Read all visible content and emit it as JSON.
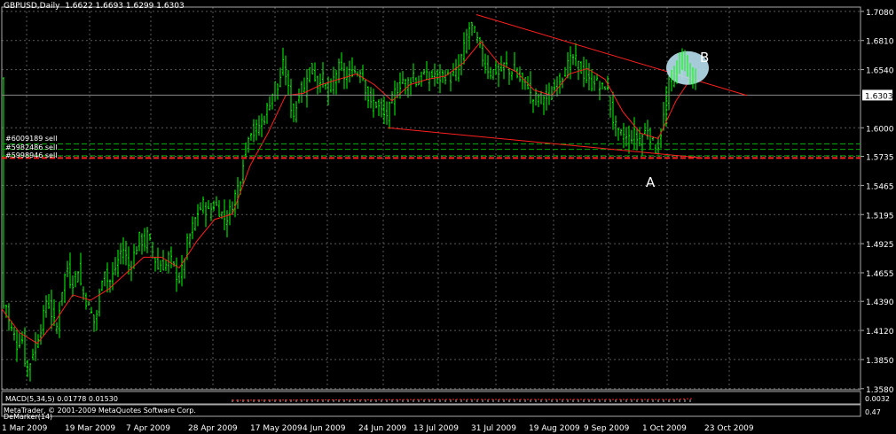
{
  "header": {
    "symbol": "GBPUSD,Daily",
    "ohlc": "1.6622 1.6693 1.6299 1.6303"
  },
  "orders": [
    {
      "label": "#6009189 sell",
      "price": 1.585
    },
    {
      "label": "#5982486 sell",
      "price": 1.58
    },
    {
      "label": "#5998946 sell",
      "price": 1.574
    }
  ],
  "red_level": 1.572,
  "annotations": {
    "a": "A",
    "b": "B"
  },
  "macd": {
    "label": "MACD(5,34,5) 0.01778 0.01530",
    "right_values": [
      "0.0032",
      "0.00"
    ],
    "copyright": "MetaTrader, © 2001-2009 MetaQuotes Software Corp.",
    "lower_label": "DeMarker(14)",
    "lower_value": "0.47"
  },
  "colors": {
    "background": "#000000",
    "grid": "#5a5a5a",
    "bar": "#00ff00",
    "ma": "#ff2020",
    "trendline": "#ff2020",
    "order_line": "#00aa00",
    "highlight": "#b8e0ee"
  },
  "chart_data": {
    "type": "ohlc",
    "symbol": "GBPUSD",
    "timeframe": "Daily",
    "ylim": [
      1.357,
      1.712
    ],
    "y_ticks": [
      "1.7080",
      "1.6810",
      "1.6540",
      "1.6303",
      "1.6000",
      "1.5735",
      "1.5465",
      "1.5195",
      "1.4925",
      "1.4655",
      "1.4390",
      "1.4120",
      "1.3850",
      "1.3580"
    ],
    "current_price": "1.6303",
    "x_ticks": [
      "1 Mar 2009",
      "19 Mar 2009",
      "7 Apr 2009",
      "28 Apr 2009",
      "17 May 2009",
      "4 Jun 2009",
      "24 Jun 2009",
      "13 Jul 2009",
      "31 Jul 2009",
      "19 Aug 2009",
      "9 Sep 2009",
      "1 Oct 2009",
      "23 Oct 2009"
    ],
    "series": [
      {
        "kind": "close_path",
        "points": [
          [
            0,
            1.43
          ],
          [
            4,
            1.44
          ],
          [
            8,
            1.42
          ],
          [
            12,
            1.41
          ],
          [
            15,
            1.405
          ],
          [
            18,
            1.395
          ],
          [
            22,
            1.41
          ],
          [
            26,
            1.385
          ],
          [
            30,
            1.375
          ],
          [
            34,
            1.39
          ],
          [
            38,
            1.4
          ],
          [
            42,
            1.41
          ],
          [
            46,
            1.42
          ],
          [
            50,
            1.44
          ],
          [
            54,
            1.435
          ],
          [
            58,
            1.42
          ],
          [
            62,
            1.415
          ],
          [
            66,
            1.44
          ],
          [
            70,
            1.46
          ],
          [
            74,
            1.47
          ],
          [
            78,
            1.455
          ],
          [
            82,
            1.46
          ],
          [
            86,
            1.47
          ],
          [
            90,
            1.45
          ],
          [
            95,
            1.44
          ],
          [
            100,
            1.43
          ],
          [
            104,
            1.42
          ],
          [
            108,
            1.43
          ],
          [
            112,
            1.46
          ],
          [
            116,
            1.47
          ],
          [
            120,
            1.455
          ],
          [
            124,
            1.46
          ],
          [
            128,
            1.47
          ],
          [
            132,
            1.48
          ],
          [
            136,
            1.49
          ],
          [
            140,
            1.48
          ],
          [
            144,
            1.47
          ],
          [
            148,
            1.48
          ],
          [
            152,
            1.49
          ],
          [
            156,
            1.5
          ],
          [
            160,
            1.49
          ],
          [
            164,
            1.5
          ],
          [
            168,
            1.49
          ],
          [
            172,
            1.48
          ],
          [
            176,
            1.47
          ],
          [
            180,
            1.475
          ],
          [
            184,
            1.47
          ],
          [
            188,
            1.48
          ],
          [
            192,
            1.475
          ],
          [
            196,
            1.465
          ],
          [
            200,
            1.46
          ],
          [
            204,
            1.47
          ],
          [
            208,
            1.49
          ],
          [
            212,
            1.5
          ],
          [
            216,
            1.51
          ],
          [
            220,
            1.52
          ],
          [
            224,
            1.525
          ],
          [
            228,
            1.53
          ],
          [
            232,
            1.52
          ],
          [
            236,
            1.525
          ],
          [
            240,
            1.53
          ],
          [
            244,
            1.525
          ],
          [
            248,
            1.52
          ],
          [
            252,
            1.515
          ],
          [
            256,
            1.52
          ],
          [
            260,
            1.53
          ],
          [
            264,
            1.54
          ],
          [
            268,
            1.55
          ],
          [
            272,
            1.57
          ],
          [
            276,
            1.59
          ],
          [
            280,
            1.6
          ],
          [
            284,
            1.595
          ],
          [
            288,
            1.6
          ],
          [
            292,
            1.605
          ],
          [
            296,
            1.61
          ],
          [
            300,
            1.62
          ],
          [
            304,
            1.63
          ],
          [
            308,
            1.64
          ],
          [
            312,
            1.635
          ],
          [
            316,
            1.66
          ],
          [
            320,
            1.65
          ],
          [
            324,
            1.63
          ],
          [
            328,
            1.61
          ],
          [
            332,
            1.62
          ],
          [
            336,
            1.64
          ],
          [
            340,
            1.63
          ],
          [
            344,
            1.65
          ],
          [
            348,
            1.655
          ],
          [
            352,
            1.65
          ],
          [
            356,
            1.64
          ],
          [
            360,
            1.65
          ],
          [
            364,
            1.64
          ],
          [
            368,
            1.63
          ],
          [
            372,
            1.64
          ],
          [
            376,
            1.65
          ],
          [
            380,
            1.655
          ],
          [
            384,
            1.65
          ],
          [
            388,
            1.645
          ],
          [
            392,
            1.65
          ],
          [
            396,
            1.655
          ],
          [
            400,
            1.65
          ],
          [
            404,
            1.655
          ],
          [
            408,
            1.645
          ],
          [
            412,
            1.63
          ],
          [
            416,
            1.62
          ],
          [
            420,
            1.625
          ],
          [
            424,
            1.62
          ],
          [
            428,
            1.615
          ],
          [
            432,
            1.61
          ],
          [
            436,
            1.615
          ],
          [
            440,
            1.625
          ],
          [
            444,
            1.635
          ],
          [
            448,
            1.64
          ],
          [
            452,
            1.645
          ],
          [
            456,
            1.64
          ],
          [
            460,
            1.645
          ],
          [
            464,
            1.65
          ],
          [
            468,
            1.64
          ],
          [
            472,
            1.645
          ],
          [
            476,
            1.65
          ],
          [
            480,
            1.645
          ],
          [
            484,
            1.648
          ],
          [
            488,
            1.65
          ],
          [
            492,
            1.645
          ],
          [
            496,
            1.648
          ],
          [
            500,
            1.65
          ],
          [
            504,
            1.645
          ],
          [
            508,
            1.648
          ],
          [
            512,
            1.65
          ],
          [
            516,
            1.66
          ],
          [
            520,
            1.67
          ],
          [
            524,
            1.685
          ],
          [
            528,
            1.695
          ],
          [
            532,
            1.69
          ],
          [
            536,
            1.68
          ],
          [
            540,
            1.67
          ],
          [
            544,
            1.66
          ],
          [
            548,
            1.655
          ],
          [
            552,
            1.65
          ],
          [
            556,
            1.655
          ],
          [
            560,
            1.65
          ],
          [
            564,
            1.655
          ],
          [
            568,
            1.66
          ],
          [
            572,
            1.65
          ],
          [
            576,
            1.655
          ],
          [
            580,
            1.65
          ],
          [
            584,
            1.645
          ],
          [
            588,
            1.64
          ],
          [
            592,
            1.645
          ],
          [
            596,
            1.63
          ],
          [
            600,
            1.625
          ],
          [
            604,
            1.63
          ],
          [
            608,
            1.628
          ],
          [
            612,
            1.63
          ],
          [
            616,
            1.625
          ],
          [
            620,
            1.63
          ],
          [
            624,
            1.64
          ],
          [
            628,
            1.645
          ],
          [
            632,
            1.65
          ],
          [
            636,
            1.655
          ],
          [
            640,
            1.66
          ],
          [
            644,
            1.665
          ],
          [
            648,
            1.66
          ],
          [
            652,
            1.655
          ],
          [
            656,
            1.65
          ],
          [
            660,
            1.645
          ],
          [
            664,
            1.64
          ],
          [
            668,
            1.645
          ],
          [
            672,
            1.64
          ],
          [
            676,
            1.635
          ],
          [
            680,
            1.64
          ],
          [
            684,
            1.63
          ],
          [
            688,
            1.61
          ],
          [
            692,
            1.6
          ],
          [
            696,
            1.59
          ],
          [
            700,
            1.595
          ],
          [
            704,
            1.59
          ],
          [
            708,
            1.59
          ],
          [
            712,
            1.595
          ],
          [
            716,
            1.59
          ],
          [
            720,
            1.59
          ],
          [
            724,
            1.595
          ],
          [
            728,
            1.6
          ],
          [
            732,
            1.59
          ],
          [
            736,
            1.58
          ],
          [
            740,
            1.585
          ],
          [
            744,
            1.6
          ],
          [
            748,
            1.62
          ],
          [
            752,
            1.64
          ],
          [
            756,
            1.645
          ],
          [
            760,
            1.65
          ],
          [
            764,
            1.66
          ],
          [
            768,
            1.665
          ],
          [
            772,
            1.66
          ],
          [
            776,
            1.65
          ],
          [
            780,
            1.645
          ]
        ]
      }
    ],
    "moving_average": [
      [
        0,
        1.432
      ],
      [
        20,
        1.41
      ],
      [
        40,
        1.4
      ],
      [
        60,
        1.42
      ],
      [
        80,
        1.445
      ],
      [
        100,
        1.44
      ],
      [
        120,
        1.45
      ],
      [
        140,
        1.465
      ],
      [
        160,
        1.48
      ],
      [
        180,
        1.48
      ],
      [
        200,
        1.47
      ],
      [
        220,
        1.495
      ],
      [
        240,
        1.515
      ],
      [
        260,
        1.52
      ],
      [
        280,
        1.565
      ],
      [
        300,
        1.595
      ],
      [
        320,
        1.63
      ],
      [
        340,
        1.632
      ],
      [
        360,
        1.64
      ],
      [
        380,
        1.645
      ],
      [
        400,
        1.65
      ],
      [
        420,
        1.64
      ],
      [
        440,
        1.625
      ],
      [
        460,
        1.64
      ],
      [
        480,
        1.645
      ],
      [
        500,
        1.648
      ],
      [
        520,
        1.66
      ],
      [
        540,
        1.68
      ],
      [
        560,
        1.66
      ],
      [
        580,
        1.652
      ],
      [
        600,
        1.635
      ],
      [
        620,
        1.63
      ],
      [
        640,
        1.65
      ],
      [
        660,
        1.655
      ],
      [
        680,
        1.645
      ],
      [
        700,
        1.615
      ],
      [
        720,
        1.595
      ],
      [
        740,
        1.59
      ],
      [
        760,
        1.625
      ],
      [
        780,
        1.65
      ]
    ],
    "trendlines": [
      {
        "from": [
          535,
          1.705
        ],
        "to": [
          840,
          1.63
        ]
      },
      {
        "from": [
          435,
          1.6
        ],
        "to": [
          790,
          1.572
        ]
      }
    ]
  }
}
